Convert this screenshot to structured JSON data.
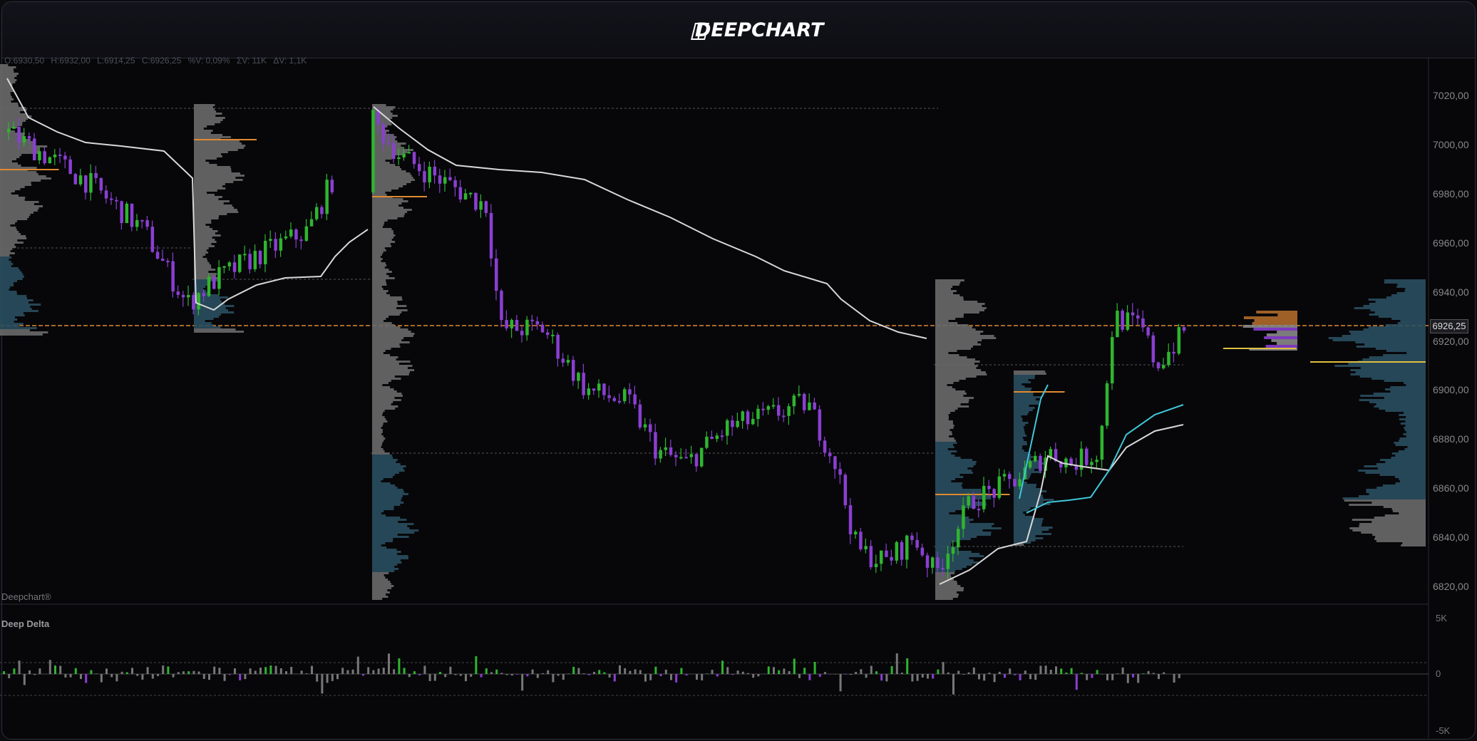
{
  "app": {
    "logo_text": "DEEPCHART"
  },
  "ohlc": {
    "o": "O:6930,50",
    "h": "H:6932,00",
    "l": "L:6914,25",
    "c": "C:6926,25",
    "pct": "%V: 0,09%",
    "v": "ΣV: 11K",
    "dv": "ΔV: 1,1K"
  },
  "price_axis": {
    "ticks": [
      "7020,00",
      "7000,00",
      "6980,00",
      "6960,00",
      "6940,00",
      "6920,00",
      "6900,00",
      "6880,00",
      "6860,00",
      "6840,00",
      "6820,00"
    ],
    "current_price": "6926,25"
  },
  "watermark": "Deepchart®",
  "delta_panel": {
    "title": "Deep Delta",
    "ticks": [
      "5K",
      "0",
      "-5K"
    ]
  },
  "colors": {
    "up": "#2fb52f",
    "down": "#8a3fd1",
    "vwap": "#d8d8d8",
    "vwap2": "#3fc8d8",
    "poc": "#e08a2e",
    "profile": "#6a6a6a",
    "value_area": "#2a4f5f",
    "current_line": "#e08a2e"
  },
  "chart_data": {
    "type": "candlestick",
    "instrument_price_range": [
      6815,
      7030
    ],
    "current_price": 6926.25
  }
}
